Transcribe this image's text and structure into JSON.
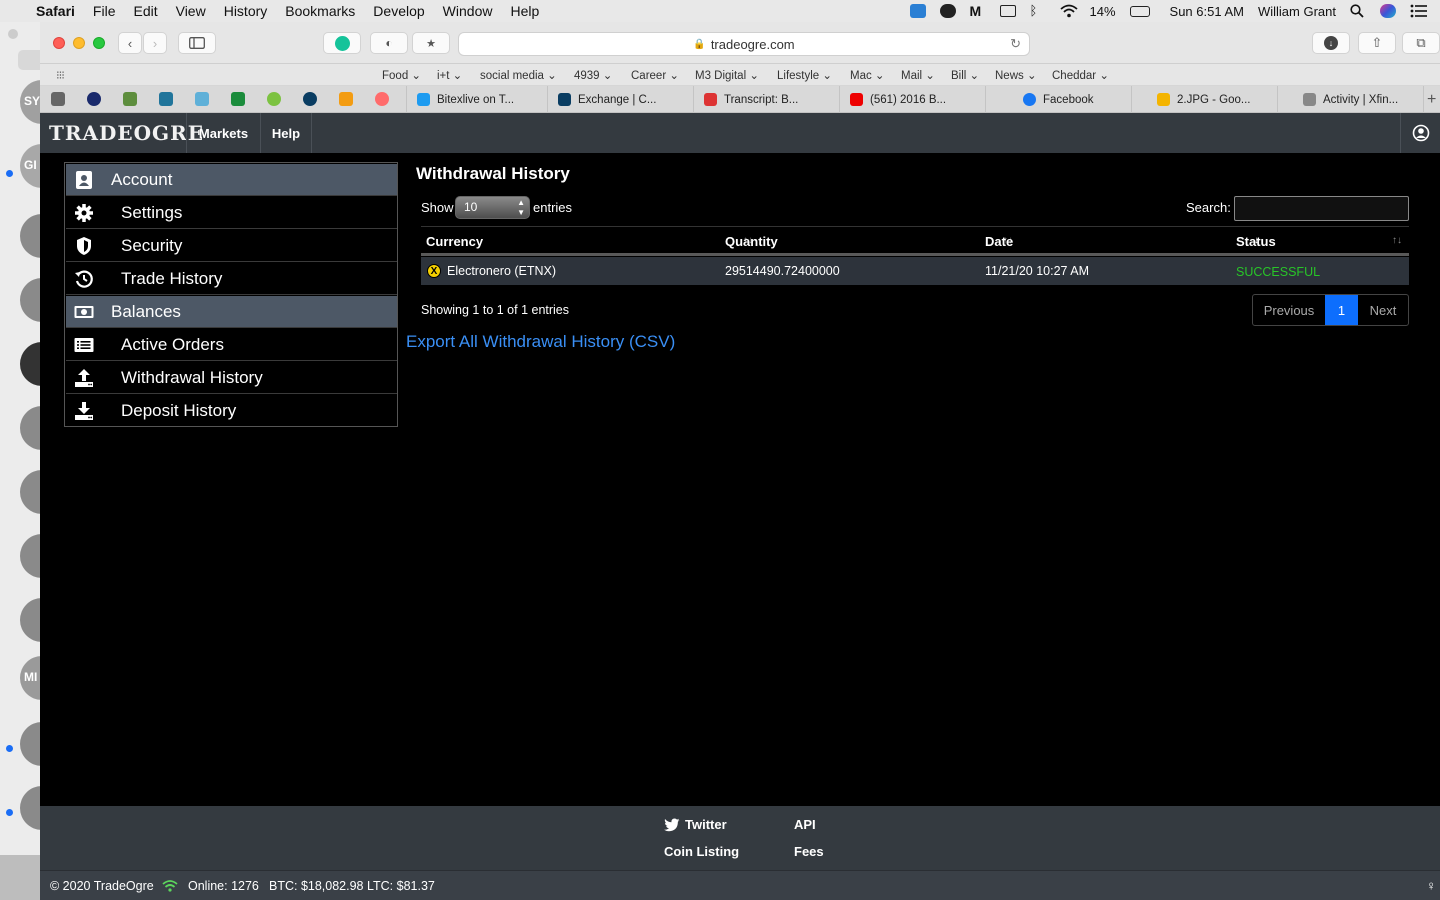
{
  "menubar": {
    "app": "Safari",
    "items": [
      "File",
      "Edit",
      "View",
      "History",
      "Bookmarks",
      "Develop",
      "Window",
      "Help"
    ],
    "battery": "14%",
    "clock": "Sun 6:51 AM",
    "user": "William Grant"
  },
  "background_app": {
    "labels": [
      "SY",
      "GI",
      "MI"
    ]
  },
  "toolbar": {
    "url": "tradeogre.com"
  },
  "favorites": [
    "Food",
    "i+t",
    "social media",
    "4939",
    "Career",
    "M3 Digital",
    "Lifestyle",
    "Mac",
    "Mail",
    "Bill",
    "News",
    "Cheddar"
  ],
  "tabs": [
    {
      "label": "Bitexlive on T...",
      "color": "#1d9bf0"
    },
    {
      "label": "Exchange | C...",
      "color": "#0a3d62"
    },
    {
      "label": "Transcript: B...",
      "color": "#d33"
    },
    {
      "label": "(561) 2016 B...",
      "color": "#e00"
    },
    {
      "label": "Facebook",
      "color": "#1877f2"
    },
    {
      "label": "2.JPG - Goo...",
      "color": "#f4b400"
    },
    {
      "label": "Activity | Xfin...",
      "color": "#777"
    }
  ],
  "site": {
    "logo": "TRADEOGRE",
    "nav": {
      "markets": "Markets",
      "help": "Help"
    }
  },
  "sidebar": {
    "items": [
      {
        "label": "Account"
      },
      {
        "label": "Settings"
      },
      {
        "label": "Security"
      },
      {
        "label": "Trade History"
      },
      {
        "label": "Balances"
      },
      {
        "label": "Active Orders"
      },
      {
        "label": "Withdrawal History"
      },
      {
        "label": "Deposit History"
      }
    ]
  },
  "main": {
    "title": "Withdrawal History",
    "show_label": "Show",
    "entries_value": "10",
    "entries_label": "entries",
    "search_label": "Search:",
    "columns": [
      "Currency",
      "Quantity",
      "Date",
      "Status"
    ],
    "rows": [
      {
        "currency": "Electronero (ETNX)",
        "quantity": "29514490.72400000",
        "date": "11/21/20 10:27 AM",
        "status": "SUCCESSFUL"
      }
    ],
    "info": "Showing 1 to 1 of 1 entries",
    "pager": {
      "previous": "Previous",
      "page": "1",
      "next": "Next"
    },
    "export": "Export All Withdrawal History (CSV)"
  },
  "footer": {
    "links": {
      "twitter": "Twitter",
      "api": "API",
      "coin_listing": "Coin Listing",
      "fees": "Fees"
    }
  },
  "statusbar": {
    "copyright": "© 2020 TradeOgre",
    "online": "Online: 1276",
    "btc": "BTC: $18,082.98",
    "ltc": "LTC: $81.37"
  },
  "colors": {
    "accent": "#0d6efd",
    "success": "#28a745",
    "nav": "#343a40",
    "highlight": "#4d5866",
    "link": "#3a8ff5"
  }
}
